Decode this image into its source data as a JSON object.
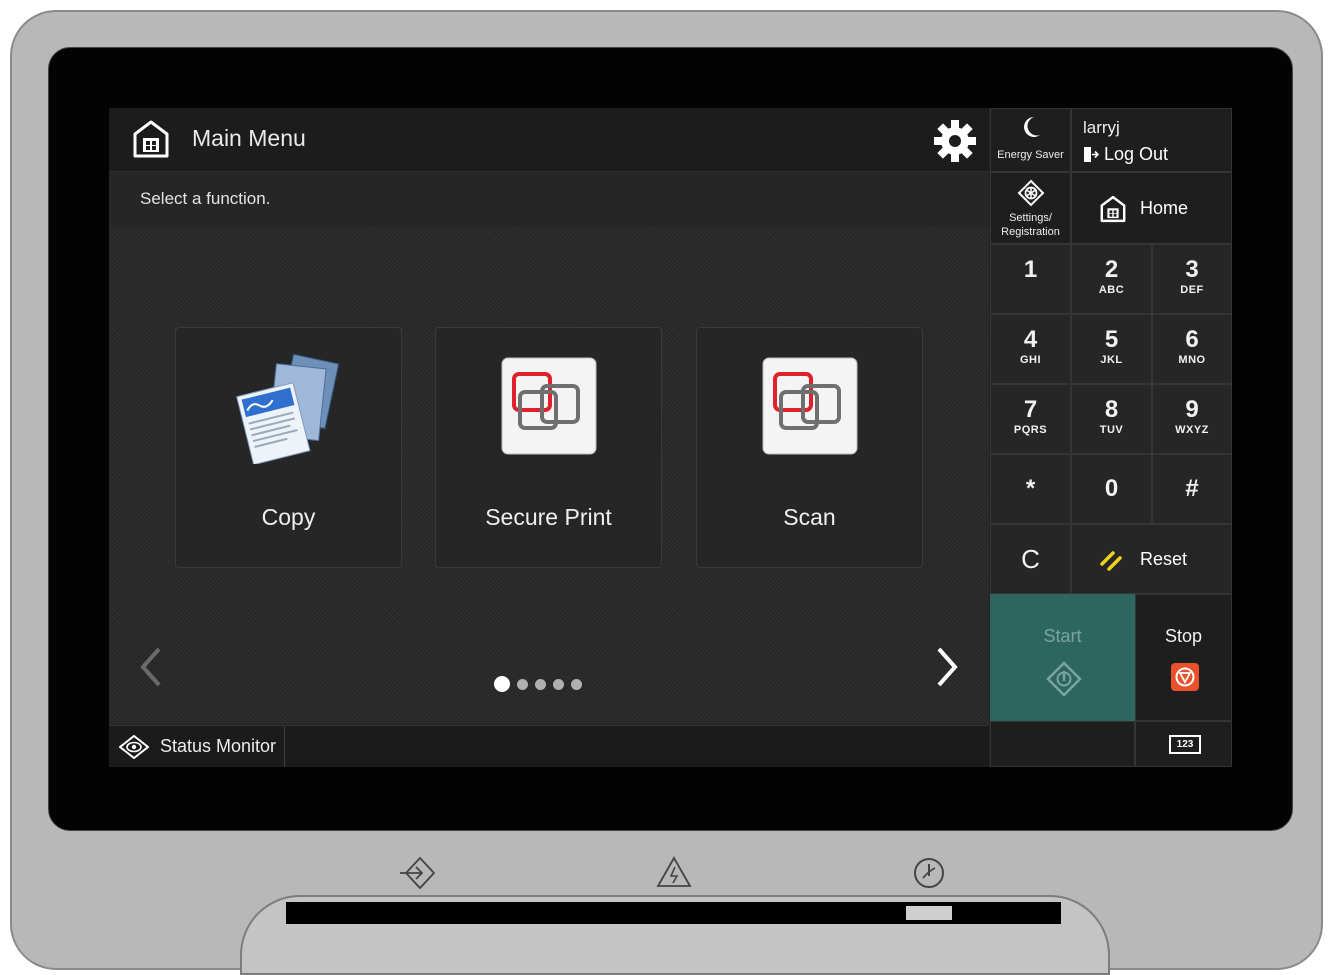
{
  "header": {
    "title": "Main Menu"
  },
  "instruction": "Select a function.",
  "functions": [
    {
      "label": "Copy"
    },
    {
      "label": "Secure Print"
    },
    {
      "label": "Scan"
    }
  ],
  "pagination": {
    "current_page": 1,
    "total_pages": 5
  },
  "footer": {
    "status_monitor": "Status Monitor"
  },
  "panel": {
    "energy_saver": "Energy Saver",
    "user": "larryj",
    "logout": "Log Out",
    "settings_line1": "Settings/",
    "settings_line2": "Registration",
    "home": "Home",
    "keypad": [
      {
        "num": "1",
        "sub": ""
      },
      {
        "num": "2",
        "sub": "ABC"
      },
      {
        "num": "3",
        "sub": "DEF"
      },
      {
        "num": "4",
        "sub": "GHI"
      },
      {
        "num": "5",
        "sub": "JKL"
      },
      {
        "num": "6",
        "sub": "MNO"
      },
      {
        "num": "7",
        "sub": "PQRS"
      },
      {
        "num": "8",
        "sub": "TUV"
      },
      {
        "num": "9",
        "sub": "WXYZ"
      },
      {
        "num": "*",
        "sub": ""
      },
      {
        "num": "0",
        "sub": ""
      },
      {
        "num": "#",
        "sub": ""
      }
    ],
    "clear": "C",
    "reset": "Reset",
    "start": "Start",
    "stop": "Stop",
    "keypad_toggle": "123"
  },
  "colors": {
    "start_green": "#2d655f",
    "stop_orange": "#e8512b",
    "reset_yellow": "#f1d21c",
    "secure_red": "#e0202a"
  }
}
